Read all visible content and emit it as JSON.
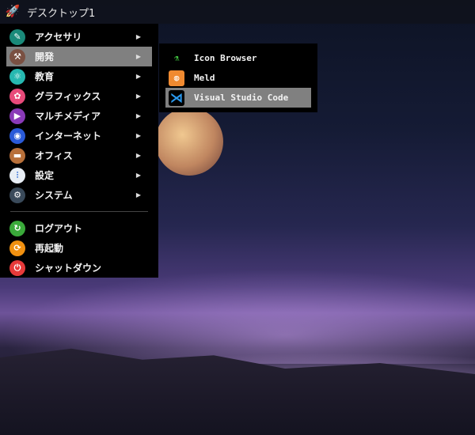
{
  "topbar": {
    "title": "デスクトップ1",
    "icon": "rocket-icon"
  },
  "menu": {
    "items": [
      {
        "label": "アクセサリ",
        "icon": "accessories-icon",
        "color": "#1a8a7a",
        "submenu": true
      },
      {
        "label": "開発",
        "icon": "hammer-icon",
        "color": "#7a5042",
        "submenu": true,
        "active": true
      },
      {
        "label": "教育",
        "icon": "education-icon",
        "color": "#26b8b0",
        "submenu": true
      },
      {
        "label": "グラフィックス",
        "icon": "graphics-icon",
        "color": "#e84a7a",
        "submenu": true
      },
      {
        "label": "マルチメディア",
        "icon": "multimedia-icon",
        "color": "#8a3ab8",
        "submenu": true
      },
      {
        "label": "インターネット",
        "icon": "internet-icon",
        "color": "#2a5ad8",
        "submenu": true
      },
      {
        "label": "オフィス",
        "icon": "briefcase-icon",
        "color": "#b8703a",
        "submenu": true
      },
      {
        "label": "設定",
        "icon": "settings-icon",
        "color": "#e8eef5",
        "submenu": true
      },
      {
        "label": "システム",
        "icon": "gear-icon",
        "color": "#3a4a5a",
        "submenu": true
      }
    ],
    "session": [
      {
        "label": "ログアウト",
        "icon": "logout-icon",
        "color": "#3aaa3a"
      },
      {
        "label": "再起動",
        "icon": "restart-icon",
        "color": "#f09010"
      },
      {
        "label": "シャットダウン",
        "icon": "power-icon",
        "color": "#e83a3a"
      }
    ]
  },
  "submenu": {
    "items": [
      {
        "label": "Icon Browser",
        "icon": "flask-icon",
        "color": "#000"
      },
      {
        "label": "Meld",
        "icon": "meld-icon",
        "color": "#f08a30"
      },
      {
        "label": "Visual Studio Code",
        "icon": "vscode-icon",
        "color": "#000",
        "active": true
      }
    ]
  }
}
